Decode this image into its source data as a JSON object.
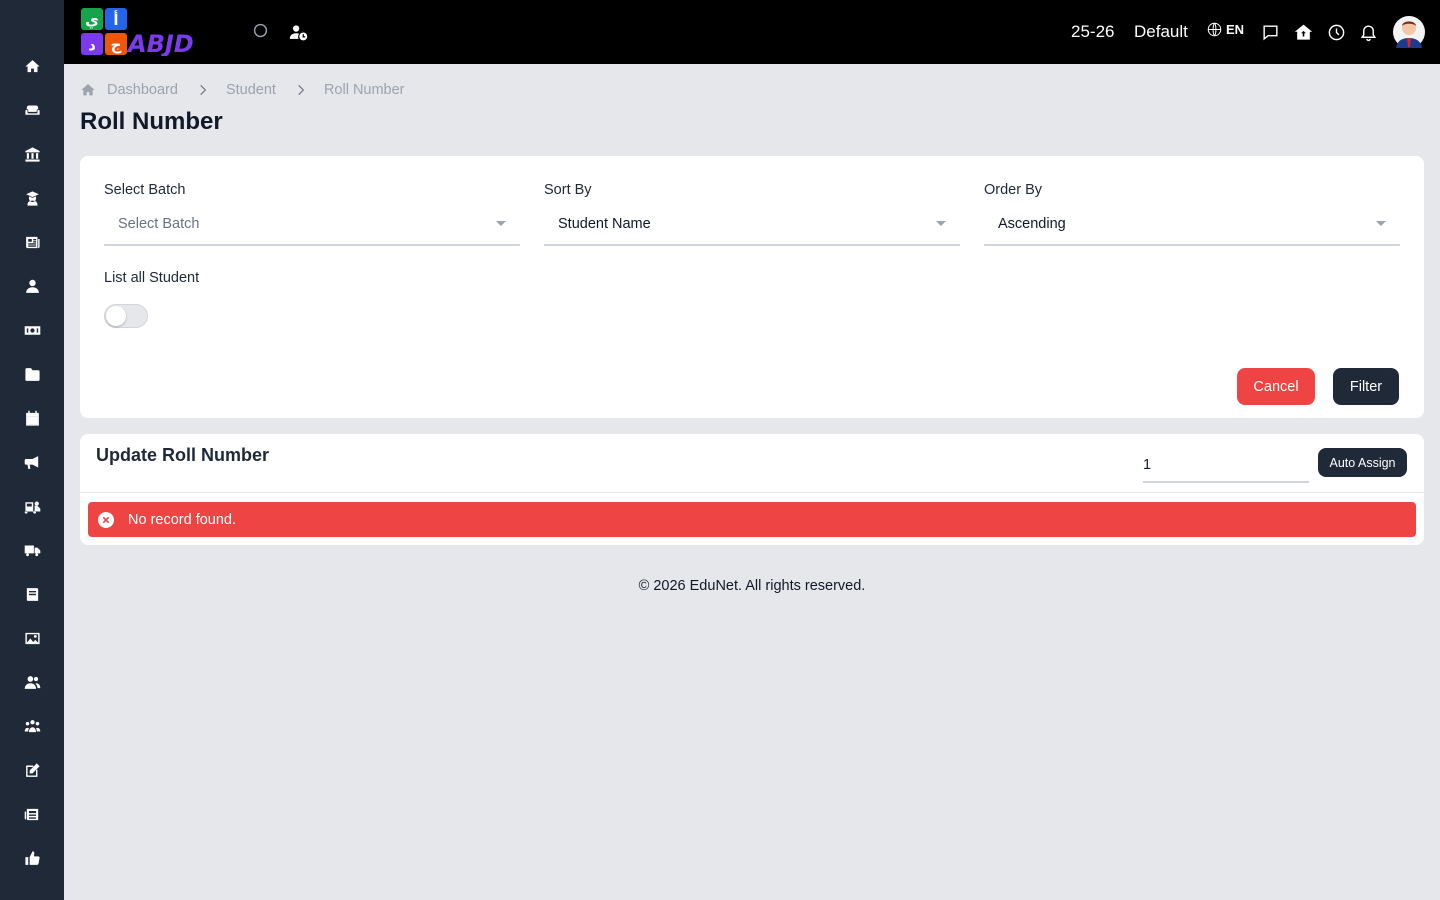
{
  "header": {
    "session": "25-26",
    "profile": "Default",
    "language": "EN",
    "logo_text": "ABJD"
  },
  "breadcrumb": [
    "Dashboard",
    "Student",
    "Roll Number"
  ],
  "page_title": "Roll Number",
  "filters": {
    "batch": {
      "label": "Select Batch",
      "placeholder": "Select Batch",
      "value": ""
    },
    "sort_by": {
      "label": "Sort By",
      "value": "Student Name"
    },
    "order_by": {
      "label": "Order By",
      "value": "Ascending"
    },
    "list_all": {
      "label": "List all Student",
      "enabled": false
    },
    "cancel_label": "Cancel",
    "filter_label": "Filter"
  },
  "update": {
    "title": "Update Roll Number",
    "start_value": "1",
    "auto_assign_label": "Auto Assign",
    "alert": "No record found."
  },
  "footer": "© 2026 EduNet. All rights reserved.",
  "colors": {
    "sidebar": "#1f2937",
    "topbar": "#000000",
    "danger": "#ef4444",
    "primary": "#1f2937"
  },
  "sidebar_icons": [
    "home-icon",
    "couch-icon",
    "institution-icon",
    "graduate-icon",
    "news-icon",
    "user-icon",
    "money-icon",
    "folder-icon",
    "calendar-icon",
    "megaphone-icon",
    "school-bus-icon",
    "truck-icon",
    "book-icon",
    "image-icon",
    "users-icon",
    "group-icon",
    "edit-icon",
    "newspaper-icon",
    "thumbs-up-icon"
  ]
}
